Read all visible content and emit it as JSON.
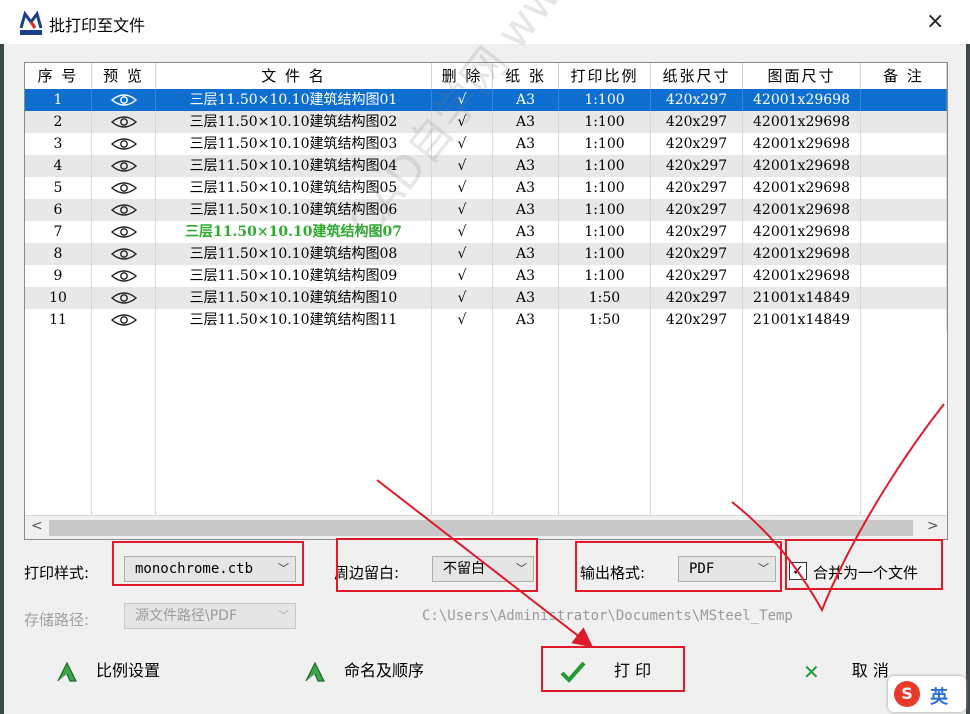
{
  "window": {
    "title": "批打印至文件",
    "close_icon": "×"
  },
  "table": {
    "headers": [
      "序 号",
      "预 览",
      "文 件 名",
      "删 除",
      "纸 张",
      "打印比例",
      "纸张尺寸",
      "图面尺寸",
      "备 注"
    ],
    "rows": [
      {
        "no": "1",
        "name": "三层11.50×10.10建筑结构图01",
        "del": "√",
        "paper": "A3",
        "scale": "1:100",
        "paper_size": "420x297",
        "drawing_size": "42001x29698",
        "note": "",
        "state": "selected"
      },
      {
        "no": "2",
        "name": "三层11.50×10.10建筑结构图02",
        "del": "√",
        "paper": "A3",
        "scale": "1:100",
        "paper_size": "420x297",
        "drawing_size": "42001x29698",
        "note": "",
        "state": "normal"
      },
      {
        "no": "3",
        "name": "三层11.50×10.10建筑结构图03",
        "del": "√",
        "paper": "A3",
        "scale": "1:100",
        "paper_size": "420x297",
        "drawing_size": "42001x29698",
        "note": "",
        "state": "normal"
      },
      {
        "no": "4",
        "name": "三层11.50×10.10建筑结构图04",
        "del": "√",
        "paper": "A3",
        "scale": "1:100",
        "paper_size": "420x297",
        "drawing_size": "42001x29698",
        "note": "",
        "state": "normal"
      },
      {
        "no": "5",
        "name": "三层11.50×10.10建筑结构图05",
        "del": "√",
        "paper": "A3",
        "scale": "1:100",
        "paper_size": "420x297",
        "drawing_size": "42001x29698",
        "note": "",
        "state": "normal"
      },
      {
        "no": "6",
        "name": "三层11.50×10.10建筑结构图06",
        "del": "√",
        "paper": "A3",
        "scale": "1:100",
        "paper_size": "420x297",
        "drawing_size": "42001x29698",
        "note": "",
        "state": "normal"
      },
      {
        "no": "7",
        "name": "三层11.50×10.10建筑结构图07",
        "del": "√",
        "paper": "A3",
        "scale": "1:100",
        "paper_size": "420x297",
        "drawing_size": "42001x29698",
        "note": "",
        "state": "highlight"
      },
      {
        "no": "8",
        "name": "三层11.50×10.10建筑结构图08",
        "del": "√",
        "paper": "A3",
        "scale": "1:100",
        "paper_size": "420x297",
        "drawing_size": "42001x29698",
        "note": "",
        "state": "normal"
      },
      {
        "no": "9",
        "name": "三层11.50×10.10建筑结构图09",
        "del": "√",
        "paper": "A3",
        "scale": "1:100",
        "paper_size": "420x297",
        "drawing_size": "42001x29698",
        "note": "",
        "state": "normal"
      },
      {
        "no": "10",
        "name": "三层11.50×10.10建筑结构图10",
        "del": "√",
        "paper": "A3",
        "scale": "1:50",
        "paper_size": "420x297",
        "drawing_size": "21001x14849",
        "note": "",
        "state": "normal"
      },
      {
        "no": "11",
        "name": "三层11.50×10.10建筑结构图11",
        "del": "√",
        "paper": "A3",
        "scale": "1:50",
        "paper_size": "420x297",
        "drawing_size": "21001x14849",
        "note": "",
        "state": "normal"
      }
    ],
    "scroll_left": "<",
    "scroll_right": ">"
  },
  "options": {
    "print_style_label": "打印样式:",
    "print_style_value": "monochrome.ctb",
    "margin_label": "周边留白:",
    "margin_value": "不留白",
    "output_format_label": "输出格式:",
    "output_format_value": "PDF",
    "merge_label": "合并为一个文件",
    "merge_checked": true,
    "save_path_label": "存储路径:",
    "save_path_value": "源文件路径\\PDF",
    "save_path_text": "C:\\Users\\Administrator\\Documents\\MSteel_Temp"
  },
  "buttons": {
    "scale_settings": "比例设置",
    "naming_order": "命名及顺序",
    "print": "打 印",
    "cancel": "取 消"
  },
  "watermark": "CAD自学网 www.cadzxw.com",
  "ime": {
    "logo": "S",
    "mode": "英"
  },
  "colors": {
    "selection": "#0f6fd0",
    "highlight_text": "#2faa2f",
    "annotation_red": "#e01a2a",
    "check_green": "#1f9a2f",
    "cancel_green": "#1c9a3a"
  }
}
